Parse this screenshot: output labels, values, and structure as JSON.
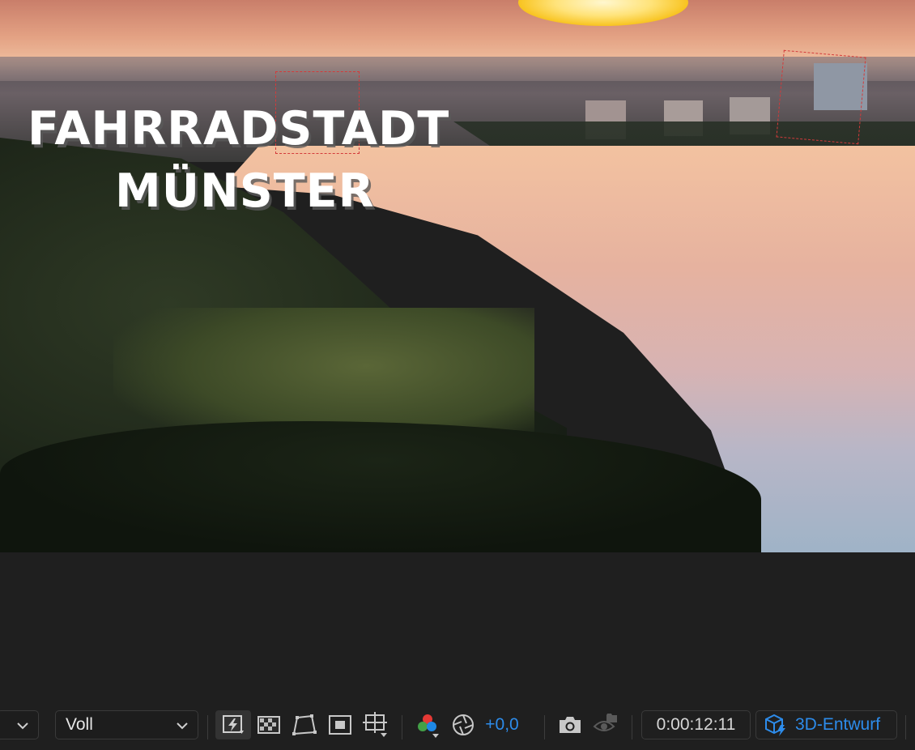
{
  "viewer": {
    "title_line1": "FAHRRADSTADT",
    "title_line2": "MÜNSTER"
  },
  "toolbar": {
    "magnification_dropdown": {
      "value": "",
      "icon": "chevron-down-icon"
    },
    "resolution_dropdown": {
      "value": "Voll",
      "icon": "chevron-down-icon"
    },
    "fast_previews_icon": "fast-previews-icon",
    "transparency_grid_icon": "transparency-grid-icon",
    "mask_visibility_icon": "mask-path-icon",
    "region_of_interest_icon": "region-of-interest-icon",
    "grid_guides_icon": "grid-guides-icon",
    "channel_icon": "rgb-channels-icon",
    "exposure_reset_icon": "exposure-aperture-icon",
    "exposure_value": "+0,0",
    "snapshot_icon": "camera-icon",
    "show_snapshot_icon": "show-snapshot-icon",
    "timecode": "0:00:12:11",
    "draft_3d_label": "3D-Entwurf",
    "draft_3d_icon": "3d-draft-icon",
    "accent_color": "#2d8ceb"
  }
}
